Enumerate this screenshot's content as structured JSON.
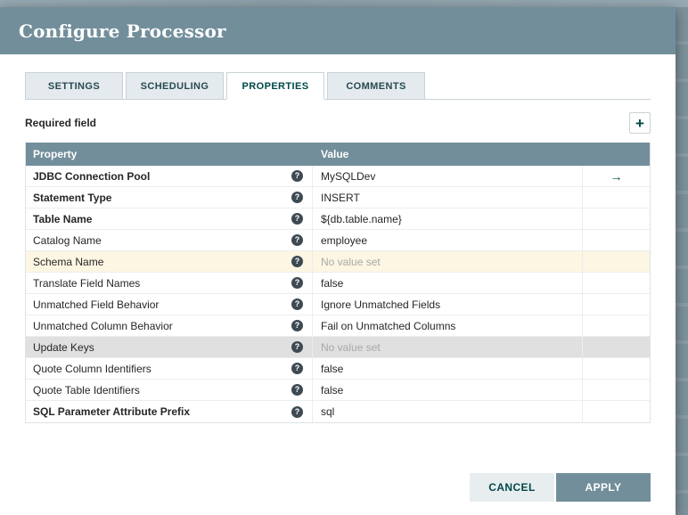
{
  "dialog": {
    "title": "Configure Processor"
  },
  "tabs": [
    {
      "label": "SETTINGS",
      "active": false
    },
    {
      "label": "SCHEDULING",
      "active": false
    },
    {
      "label": "PROPERTIES",
      "active": true
    },
    {
      "label": "COMMENTS",
      "active": false
    }
  ],
  "toolbar": {
    "required_field_label": "Required field"
  },
  "icons": {
    "add": "+",
    "help": "?",
    "go_to": "→"
  },
  "table": {
    "headers": {
      "property": "Property",
      "value": "Value"
    },
    "rows": [
      {
        "property": "JDBC Connection Pool",
        "value": "MySQLDev",
        "required": true,
        "unset": false,
        "highlight": null,
        "has_arrow": true
      },
      {
        "property": "Statement Type",
        "value": "INSERT",
        "required": true,
        "unset": false,
        "highlight": null,
        "has_arrow": false
      },
      {
        "property": "Table Name",
        "value": "${db.table.name}",
        "required": true,
        "unset": false,
        "highlight": null,
        "has_arrow": false
      },
      {
        "property": "Catalog Name",
        "value": "employee",
        "required": false,
        "unset": false,
        "highlight": null,
        "has_arrow": false
      },
      {
        "property": "Schema Name",
        "value": "No value set",
        "required": false,
        "unset": true,
        "highlight": "yellow",
        "has_arrow": false
      },
      {
        "property": "Translate Field Names",
        "value": "false",
        "required": false,
        "unset": false,
        "highlight": null,
        "has_arrow": false
      },
      {
        "property": "Unmatched Field Behavior",
        "value": "Ignore Unmatched Fields",
        "required": false,
        "unset": false,
        "highlight": null,
        "has_arrow": false
      },
      {
        "property": "Unmatched Column Behavior",
        "value": "Fail on Unmatched Columns",
        "required": false,
        "unset": false,
        "highlight": null,
        "has_arrow": false
      },
      {
        "property": "Update Keys",
        "value": "No value set",
        "required": false,
        "unset": true,
        "highlight": "gray",
        "has_arrow": false
      },
      {
        "property": "Quote Column Identifiers",
        "value": "false",
        "required": false,
        "unset": false,
        "highlight": null,
        "has_arrow": false
      },
      {
        "property": "Quote Table Identifiers",
        "value": "false",
        "required": false,
        "unset": false,
        "highlight": null,
        "has_arrow": false
      },
      {
        "property": "SQL Parameter Attribute Prefix",
        "value": "sql",
        "required": true,
        "unset": false,
        "highlight": null,
        "has_arrow": false
      }
    ]
  },
  "footer": {
    "cancel_label": "CANCEL",
    "apply_label": "APPLY"
  },
  "colors": {
    "header": "#728e9b",
    "accent": "#004849",
    "highlight_yellow": "#fdf6e3",
    "highlight_gray": "#e0e0e0"
  }
}
